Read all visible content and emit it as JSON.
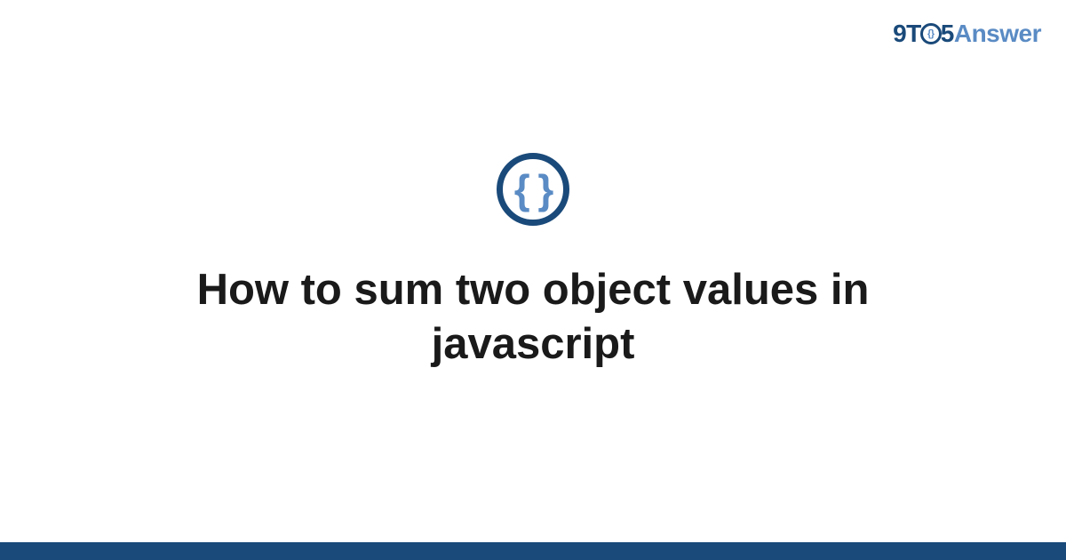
{
  "logo": {
    "part1": "9T",
    "part2": "5",
    "part3": "Answer"
  },
  "icon": {
    "braces": "{ }",
    "name": "code-braces-icon"
  },
  "title": "How to sum two object values in javascript"
}
